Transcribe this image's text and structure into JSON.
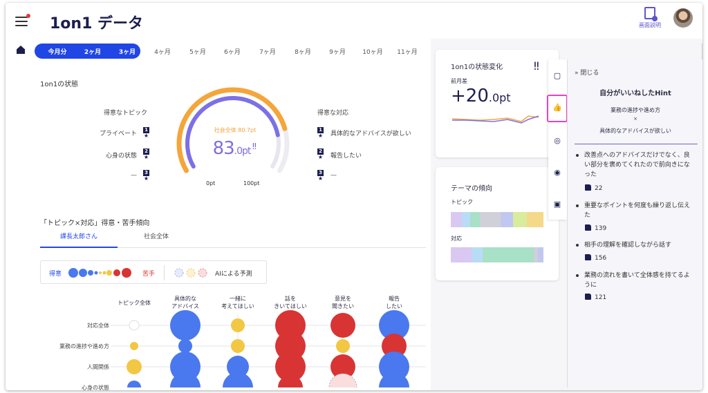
{
  "header": {
    "title": "1on1 データ",
    "help_label": "画面説明"
  },
  "period_tabs": [
    "今月分",
    "2ヶ月",
    "3ヶ月",
    "4ヶ月",
    "5ヶ月",
    "6ヶ月",
    "7ヶ月",
    "8ヶ月",
    "9ヶ月",
    "10ヶ月",
    "11ヶ月"
  ],
  "status": {
    "title": "1on1の状態",
    "good_topic_title": "得意なトピック",
    "good_topics": [
      "プライベート",
      "心身の状態",
      "—"
    ],
    "good_response_title": "得意な対応",
    "good_responses": [
      "具体的なアドバイスが欲しい",
      "報告したい",
      "—"
    ],
    "society_label": "社会全体 80.7pt",
    "score_main": "83",
    "score_decimal": ".0pt",
    "gauge_min": "0pt",
    "gauge_max": "100pt",
    "gauge_value": 0.83,
    "society_value": 0.807
  },
  "matrix": {
    "title": "「トピック×対応」得意・苦手傾向",
    "tabs": [
      "課長太郎さん",
      "社会全体"
    ],
    "legend_good": "得意",
    "legend_bad": "苦手",
    "legend_ai": "AIによる予測",
    "columns": [
      "トピック全体",
      "具体的な\nアドバイス",
      "一緒に\n考えてほしい",
      "話を\nきいてほしい",
      "意見を\n聞きたい",
      "報告\nしたい"
    ],
    "rows": [
      "対応全体",
      "業務の進捗や進め方",
      "人間関係",
      "心身の状態"
    ]
  },
  "change_card": {
    "title": "1on1の状態変化",
    "diff_label": "前月差",
    "diff_value": "+20",
    "diff_unit": ".0pt"
  },
  "theme_card": {
    "title": "テーマの傾向",
    "topic_label": "トピック",
    "response_label": "対応"
  },
  "hint": {
    "close_label": "閉じる",
    "title": "自分がいいねしたHint",
    "topic": "業務の進捗や進め方",
    "times": "×",
    "response": "具体的なアドバイスが欲しい",
    "items": [
      {
        "text": "改善点へのアドバイスだけでなく、良い部分を褒めてくれたので前向きになった",
        "likes": "22"
      },
      {
        "text": "重要なポイントを何度も繰り返し伝えた",
        "likes": "139"
      },
      {
        "text": "相手の理解を確認しながら話す",
        "likes": "156"
      },
      {
        "text": "業務の流れを書いて全体感を持てるように",
        "likes": "121"
      }
    ]
  },
  "colors": {
    "accent": "#2146e6",
    "good": "#4a78ee",
    "bad": "#d83434",
    "neutral": "#f2c744",
    "gauge_orange": "#f5a53a",
    "gauge_purple": "#7d70e6",
    "highlight": "#ec40c3"
  }
}
